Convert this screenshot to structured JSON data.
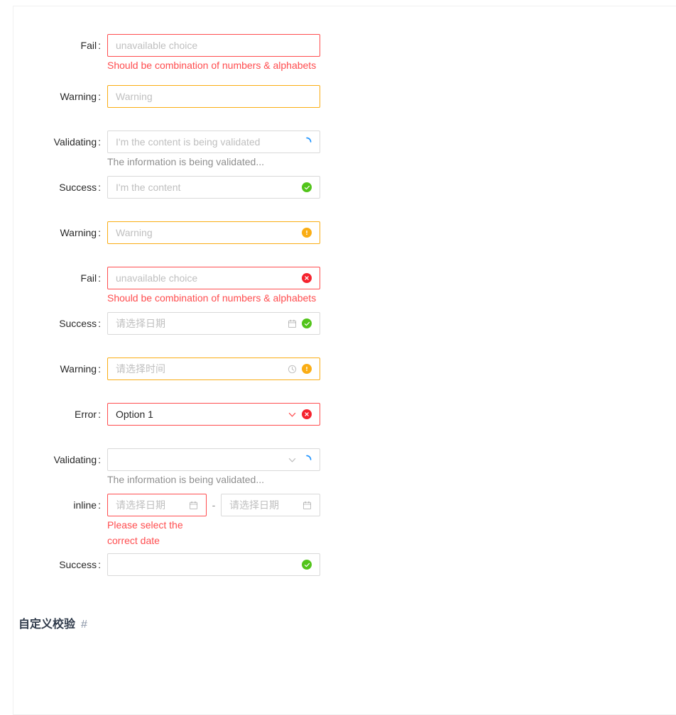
{
  "colors": {
    "error": "#ff4d4f",
    "error_strong": "#f5222d",
    "warning": "#faad14",
    "success": "#52c41a",
    "validating": "#1890ff",
    "border": "#d9d9d9",
    "placeholder": "#bfbfbf"
  },
  "bottom_heading": {
    "title": "自定义校验",
    "anchor": "#"
  },
  "rows": [
    {
      "id": "fail-input",
      "label": "Fail",
      "colon": ":",
      "status": "error",
      "control": "input",
      "placeholder": "unavailable choice",
      "value": "",
      "suffix_icon": "",
      "explain": "Should be combination of numbers & alphabets",
      "explain_type": "error"
    },
    {
      "id": "warning-input",
      "label": "Warning",
      "colon": ":",
      "status": "warning",
      "control": "input",
      "placeholder": "Warning",
      "value": "",
      "suffix_icon": "",
      "explain": "",
      "explain_type": ""
    },
    {
      "id": "validating-input",
      "label": "Validating",
      "colon": ":",
      "status": "default",
      "control": "input",
      "placeholder": "I'm the content is being validated",
      "value": "",
      "suffix_icon": "loading-spinner-icon",
      "explain": "The information is being validated...",
      "explain_type": "neutral"
    },
    {
      "id": "success-input",
      "label": "Success",
      "colon": ":",
      "status": "default",
      "control": "input",
      "placeholder": "I'm the content",
      "value": "",
      "suffix_icon": "success-check-icon",
      "explain": "",
      "explain_type": ""
    },
    {
      "id": "warning-icon-input",
      "label": "Warning",
      "colon": ":",
      "status": "warning",
      "control": "input",
      "placeholder": "Warning",
      "value": "",
      "suffix_icon": "warning-exclamation-icon",
      "explain": "",
      "explain_type": ""
    },
    {
      "id": "fail-icon-input",
      "label": "Fail",
      "colon": ":",
      "status": "error",
      "control": "input",
      "placeholder": "unavailable choice",
      "value": "",
      "suffix_icon": "error-close-icon",
      "explain": "Should be combination of numbers & alphabets",
      "explain_type": "error"
    },
    {
      "id": "success-datepicker",
      "label": "Success",
      "colon": ":",
      "status": "default",
      "control": "datepicker",
      "placeholder": "请选择日期",
      "value": "",
      "suffix_icon": "success-check-icon",
      "explain": "",
      "explain_type": ""
    },
    {
      "id": "warning-timepicker",
      "label": "Warning",
      "colon": ":",
      "status": "warning",
      "control": "timepicker",
      "placeholder": "请选择时间",
      "value": "",
      "suffix_icon": "warning-exclamation-icon",
      "explain": "",
      "explain_type": ""
    },
    {
      "id": "error-select",
      "label": "Error",
      "colon": ":",
      "status": "error",
      "control": "select",
      "placeholder": "",
      "value": "Option 1",
      "suffix_icon": "error-close-icon",
      "explain": "",
      "explain_type": ""
    },
    {
      "id": "validating-select",
      "label": "Validating",
      "colon": ":",
      "status": "default",
      "control": "select",
      "placeholder": "",
      "value": "",
      "suffix_icon": "loading-spinner-icon",
      "explain": "The information is being validated...",
      "explain_type": "neutral"
    },
    {
      "id": "inline-daterange",
      "label": "inline",
      "colon": ":",
      "status": "error",
      "control": "date-range-inline",
      "start_placeholder": "请选择日期",
      "end_placeholder": "请选择日期",
      "separator": "-",
      "explain": "Please select the correct date",
      "explain_type": "error"
    },
    {
      "id": "success-empty-input",
      "label": "Success",
      "colon": ":",
      "status": "default",
      "control": "input",
      "placeholder": "",
      "value": "",
      "suffix_icon": "success-check-icon",
      "explain": "",
      "explain_type": ""
    }
  ]
}
